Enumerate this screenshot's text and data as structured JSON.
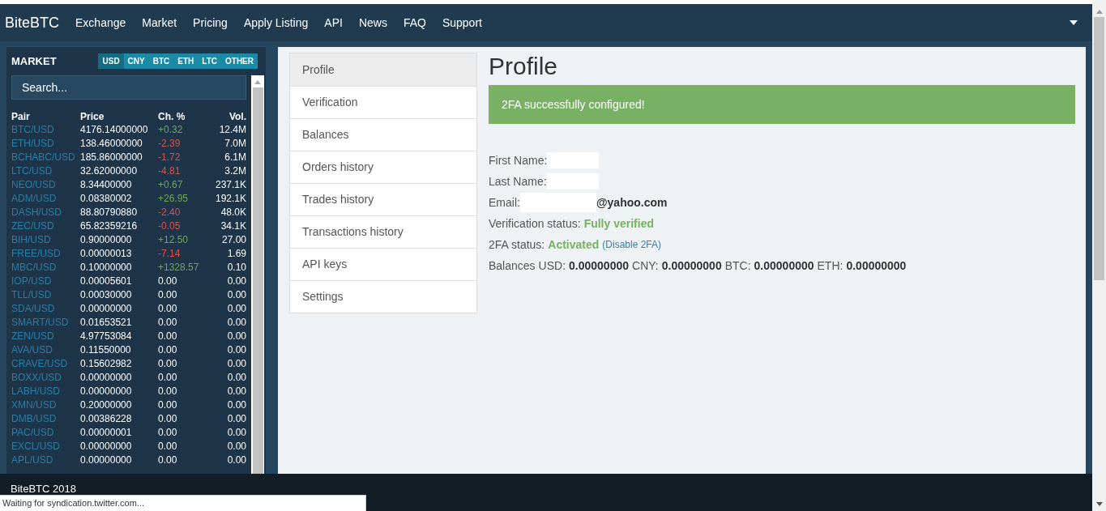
{
  "navbar": {
    "brand": "BiteBTC",
    "links": [
      "Exchange",
      "Market",
      "Pricing",
      "Apply Listing",
      "API",
      "News",
      "FAQ",
      "Support"
    ]
  },
  "market": {
    "title": "MARKET",
    "currencies": [
      {
        "label": "USD",
        "selected": true
      },
      {
        "label": "CNY",
        "selected": false
      },
      {
        "label": "BTC",
        "selected": false
      },
      {
        "label": "ETH",
        "selected": false
      },
      {
        "label": "LTC",
        "selected": false
      },
      {
        "label": "OTHER",
        "selected": false
      }
    ],
    "search": {
      "placeholder": "Search..."
    },
    "columns": [
      "Pair",
      "Price",
      "Ch. %",
      "Vol."
    ],
    "rows": [
      {
        "pair": "BTC/USD",
        "price": "4176.14000000",
        "change": "+0.32",
        "color": "#6fa85a",
        "volume": "12.4M"
      },
      {
        "pair": "ETH/USD",
        "price": "138.46000000",
        "change": "-2.39",
        "color": "#d9534f",
        "volume": "7.0M"
      },
      {
        "pair": "BCHABC/USD",
        "price": "185.86000000",
        "change": "-1.72",
        "color": "#d9534f",
        "volume": "6.1M"
      },
      {
        "pair": "LTC/USD",
        "price": "32.62000000",
        "change": "-4.81",
        "color": "#d9534f",
        "volume": "3.2M"
      },
      {
        "pair": "NEO/USD",
        "price": "8.34400000",
        "change": "+0.67",
        "color": "#6fa85a",
        "volume": "237.1K"
      },
      {
        "pair": "ADM/USD",
        "price": "0.08380002",
        "change": "+26.95",
        "color": "#6fa85a",
        "volume": "192.1K"
      },
      {
        "pair": "DASH/USD",
        "price": "88.80790880",
        "change": "-2.40",
        "color": "#d9534f",
        "volume": "48.0K"
      },
      {
        "pair": "ZEC/USD",
        "price": "65.82359216",
        "change": "-0.05",
        "color": "#d9534f",
        "volume": "34.1K"
      },
      {
        "pair": "BIH/USD",
        "price": "0.90000000",
        "change": "+12.50",
        "color": "#6fa85a",
        "volume": "27.00"
      },
      {
        "pair": "FREE/USD",
        "price": "0.00000013",
        "change": "-7.14",
        "color": "#d9534f",
        "volume": "1.69"
      },
      {
        "pair": "MBC/USD",
        "price": "0.10000000",
        "change": "+1328.57",
        "color": "#6fa85a",
        "volume": "0.10"
      },
      {
        "pair": "IOP/USD",
        "price": "0.00005601",
        "change": "0.00",
        "volume": "0.00"
      },
      {
        "pair": "TLL/USD",
        "price": "0.00030000",
        "change": "0.00",
        "volume": "0.00"
      },
      {
        "pair": "SDA/USD",
        "price": "0.00000000",
        "change": "0.00",
        "volume": "0.00"
      },
      {
        "pair": "SMART/USD",
        "price": "0.01653521",
        "change": "0.00",
        "volume": "0.00"
      },
      {
        "pair": "ZEN/USD",
        "price": "4.97753084",
        "change": "0.00",
        "volume": "0.00"
      },
      {
        "pair": "AVA/USD",
        "price": "0.11550000",
        "change": "0.00",
        "volume": "0.00"
      },
      {
        "pair": "CRAVE/USD",
        "price": "0.15602982",
        "change": "0.00",
        "volume": "0.00"
      },
      {
        "pair": "BOXX/USD",
        "price": "0.00000000",
        "change": "0.00",
        "volume": "0.00"
      },
      {
        "pair": "LABH/USD",
        "price": "0.00000000",
        "change": "0.00",
        "volume": "0.00"
      },
      {
        "pair": "XMN/USD",
        "price": "0.20000000",
        "change": "0.00",
        "volume": "0.00"
      },
      {
        "pair": "DMB/USD",
        "price": "0.00386228",
        "change": "0.00",
        "volume": "0.00"
      },
      {
        "pair": "PAC/USD",
        "price": "0.00000001",
        "change": "0.00",
        "volume": "0.00"
      },
      {
        "pair": "EXCL/USD",
        "price": "0.00000000",
        "change": "0.00",
        "volume": "0.00"
      },
      {
        "pair": "APL/USD",
        "price": "0.00000000",
        "change": "0.00",
        "volume": "0.00"
      }
    ]
  },
  "account_menu": [
    {
      "label": "Profile",
      "selected": true
    },
    {
      "label": "Verification",
      "selected": false
    },
    {
      "label": "Balances",
      "selected": false
    },
    {
      "label": "Orders history",
      "selected": false
    },
    {
      "label": "Trades history",
      "selected": false
    },
    {
      "label": "Transactions history",
      "selected": false
    },
    {
      "label": "API keys",
      "selected": false
    },
    {
      "label": "Settings",
      "selected": false
    }
  ],
  "profile": {
    "title": "Profile",
    "alert": "2FA successfully configured!",
    "lines": [
      {
        "kind": "redacted",
        "label": "First Name:"
      },
      {
        "kind": "redacted",
        "label": "Last Name:"
      },
      {
        "kind": "email",
        "label": "Email:",
        "value": "@yahoo.com"
      },
      {
        "kind": "status",
        "label": "Verification status:",
        "value": "Fully verified"
      },
      {
        "kind": "status",
        "label": "2FA status:",
        "value": "Activated",
        "link": "(Disable 2FA)"
      },
      {
        "kind": "balances",
        "label": "Balances",
        "items": [
          {
            "currency": "USD:",
            "amount": "0.00000000"
          },
          {
            "currency": "CNY:",
            "amount": "0.00000000"
          },
          {
            "currency": "BTC:",
            "amount": "0.00000000"
          },
          {
            "currency": "ETH:",
            "amount": "0.00000000"
          }
        ]
      }
    ]
  },
  "footer": {
    "text": "BiteBTC 2018"
  },
  "status_bubble": "Waiting for syndication.twitter.com..."
}
